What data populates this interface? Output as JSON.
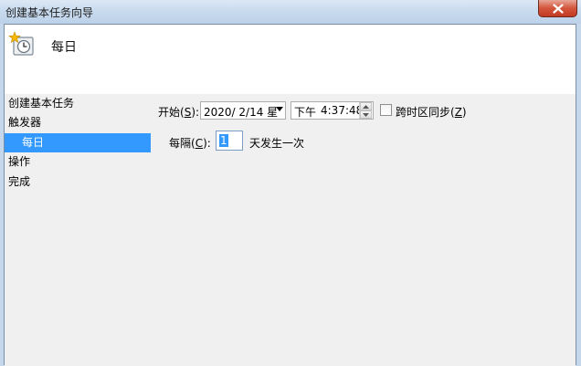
{
  "window": {
    "title": "创建基本任务向导"
  },
  "header": {
    "title": "每日",
    "icon": "task-scheduler-clock-icon"
  },
  "sidebar": {
    "items": [
      {
        "label": "创建基本任务"
      },
      {
        "label": "触发器"
      },
      {
        "label": "每日",
        "selected": true
      },
      {
        "label": "操作"
      },
      {
        "label": "完成"
      }
    ]
  },
  "form": {
    "start_label_pre": "开始(",
    "start_label_key": "S",
    "start_label_post": "):",
    "date_value": "2020/  2/14 星",
    "time_ampm": "下午",
    "time_value": "4:37:48",
    "sync_label_pre": "跨时区同步(",
    "sync_label_key": "Z",
    "sync_label_post": ")",
    "sync_checked": false,
    "recur_label_pre": "每隔(",
    "recur_label_key": "C",
    "recur_label_post": "):",
    "recur_value": "1",
    "recur_suffix": "天发生一次"
  },
  "colors": {
    "selection": "#3399ff",
    "close_button": "#c13a22"
  }
}
